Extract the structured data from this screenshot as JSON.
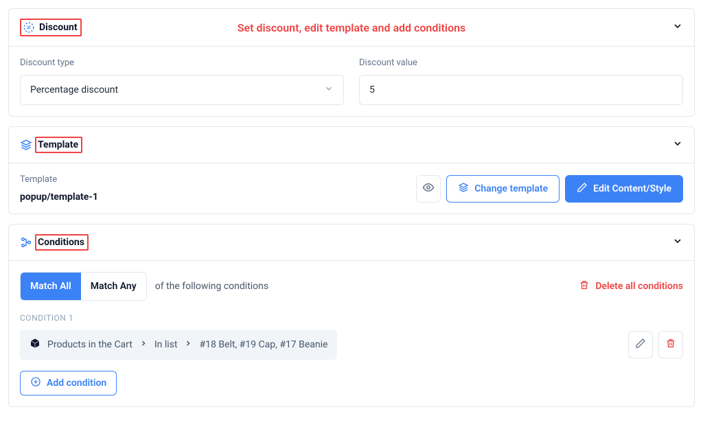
{
  "annotation": "Set discount, edit template and add conditions",
  "discount": {
    "section_title": "Discount",
    "type_label": "Discount type",
    "type_value": "Percentage discount",
    "value_label": "Discount value",
    "value": "5"
  },
  "template": {
    "section_title": "Template",
    "field_label": "Template",
    "name": "popup/template-1",
    "change_label": "Change template",
    "edit_label": "Edit Content/Style"
  },
  "conditions": {
    "section_title": "Conditions",
    "match_all": "Match All",
    "match_any": "Match Any",
    "caption": "of the following conditions",
    "delete_all": "Delete all conditions",
    "group_label": "CONDITION 1",
    "item": {
      "subject": "Products in the Cart",
      "operator": "In list",
      "value": "#18 Belt, #19 Cap, #17 Beanie"
    },
    "add_label": "Add condition"
  }
}
